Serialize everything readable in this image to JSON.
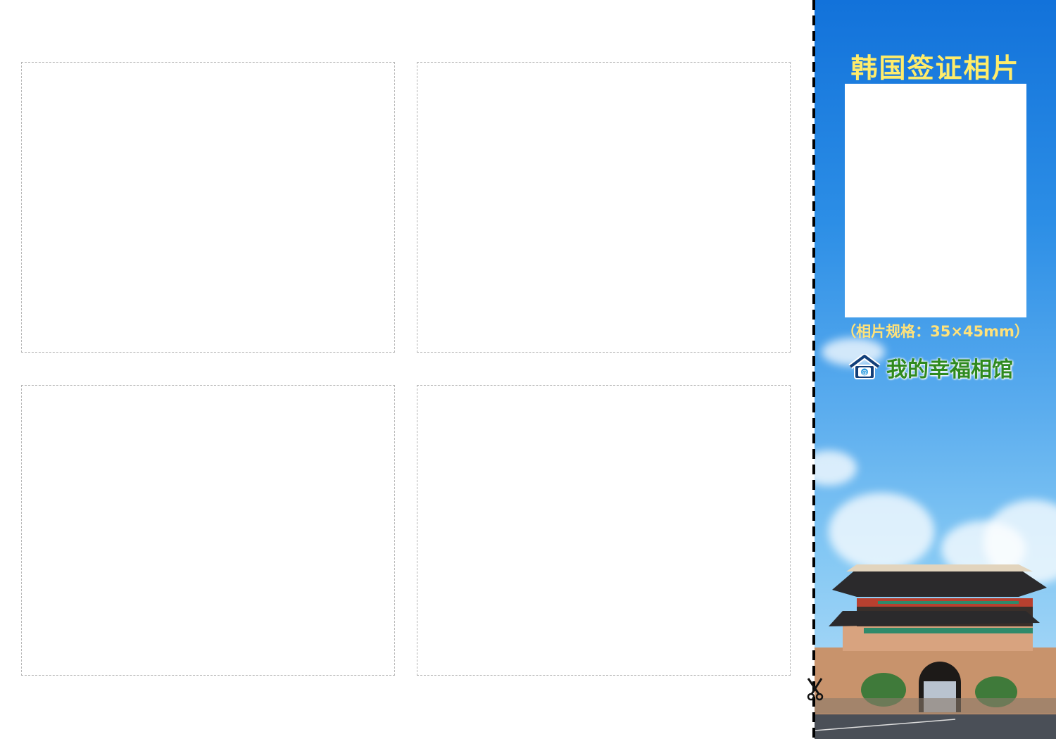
{
  "panel": {
    "title": "韩国签证相片",
    "spec": "（相片规格：35×45mm）",
    "brand": "我的幸福相馆",
    "brand_icon": "house-at-icon",
    "title_color": "#ffec6a",
    "brand_color": "#2f8a1f"
  },
  "photo_slots": 4
}
